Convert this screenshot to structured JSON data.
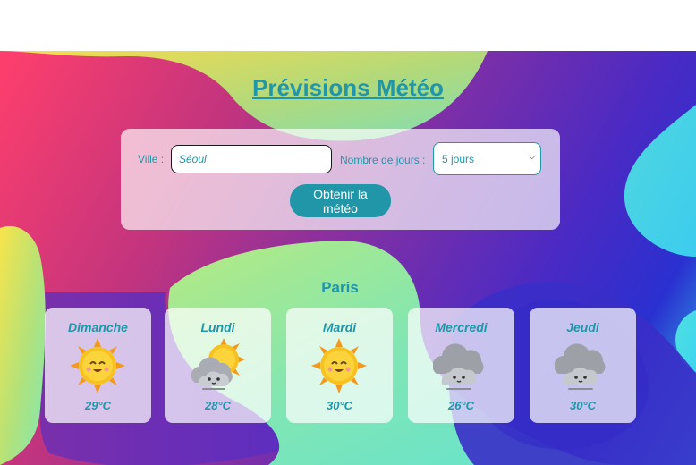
{
  "header": {
    "title": "Prévisions Météo"
  },
  "form": {
    "city_label": "Ville :",
    "city_value": "Séoul",
    "days_label": "Nombre de jours :",
    "days_selected": "5 jours",
    "submit_label": "Obtenir la météo"
  },
  "result": {
    "city": "Paris",
    "days": [
      {
        "day": "Dimanche",
        "icon": "sun-icon",
        "temp": "29°C"
      },
      {
        "day": "Lundi",
        "icon": "cloud-sun-icon",
        "temp": "28°C"
      },
      {
        "day": "Mardi",
        "icon": "sun-icon",
        "temp": "30°C"
      },
      {
        "day": "Mercredi",
        "icon": "cloud-icon",
        "temp": "26°C"
      },
      {
        "day": "Jeudi",
        "icon": "cloud-icon",
        "temp": "30°C"
      }
    ]
  },
  "colors": {
    "accent": "#2196a8"
  }
}
